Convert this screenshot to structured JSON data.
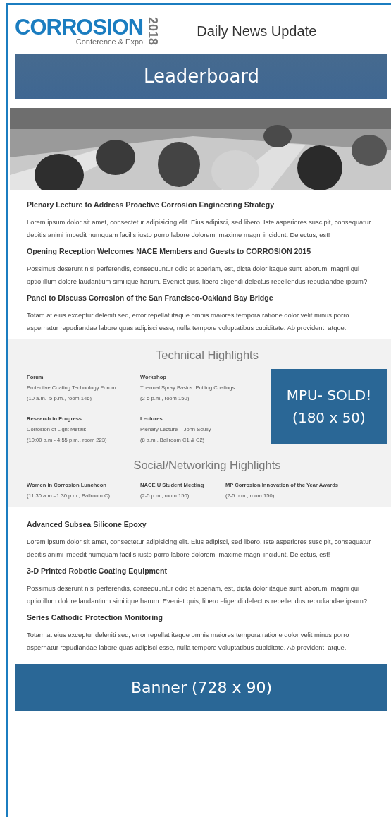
{
  "header": {
    "logo": {
      "name": "CORROSION",
      "tagline": "Conference & Expo",
      "year": "2018"
    },
    "title": "Daily News Update"
  },
  "leaderboard_ad": {
    "label": "Leaderboard"
  },
  "articles_top": [
    {
      "headline": "Plenary Lecture to Address Proactive Corrosion Engineering Strategy",
      "body": "Lorem ipsum dolor sit amet, consectetur adipisicing elit. Eius adipisci, sed libero. Iste asperiores suscipit, consequatur debitis animi impedit numquam facilis iusto porro labore dolorem, maxime magni incidunt. Delectus, est!"
    },
    {
      "headline": "Opening Reception Welcomes NACE Members and Guests to CORROSION 2015",
      "body": "Possimus deserunt nisi perferendis, consequuntur odio et aperiam, est, dicta dolor itaque sunt laborum, magni qui optio illum dolore laudantium similique harum. Eveniet quis, libero eligendi delectus repellendus repudiandae ipsum?"
    },
    {
      "headline": "Panel to Discuss Corrosion of the San Francisco-Oakland Bay Bridge",
      "body": "Totam at eius exceptur deleniti sed, error repellat itaque omnis maiores tempora ratione dolor velit minus porro aspernatur repudiandae labore quas adipisci esse, nulla tempore voluptatibus cupiditate. Ab provident, atque."
    }
  ],
  "technical_highlights": {
    "title": "Technical Highlights",
    "items": [
      {
        "category": "Forum",
        "event": "Protective Coating Technology Forum",
        "time": "(10 a.m.–5 p.m., room 146)"
      },
      {
        "category": "Workshop",
        "event": "Thermal Spray Basics: Putting Coatings",
        "time": "(2-5 p.m., room 150)"
      },
      {
        "category": "Research in Progress",
        "event": "Corrosion of Light Metals",
        "time": "(10:00 a.m - 4:55 p.m., room 223)"
      },
      {
        "category": "Lectures",
        "event": "Plenary Lecture – John Scully",
        "time": "(8 a.m., Ballroom C1 & C2)"
      }
    ]
  },
  "mpu_ad": {
    "label": "MPU- SOLD!",
    "size": "(180 x 50)"
  },
  "social_highlights": {
    "title": "Social/Networking Highlights",
    "items": [
      {
        "event": "Women in Corrosion Luncheon",
        "time": "(11:30 a.m.–1:30 p.m., Ballroom C)"
      },
      {
        "event": "NACE U Student Meeting",
        "time": "(2-5 p.m., room 150)"
      },
      {
        "event": "MP Corrosion Innovation of the Year Awards",
        "time": "(2-5 p.m., room 150)"
      }
    ]
  },
  "articles_bottom": [
    {
      "headline": "Advanced Subsea Silicone Epoxy",
      "body": "Lorem ipsum dolor sit amet, consectetur adipisicing elit. Eius adipisci, sed libero. Iste asperiores suscipit, consequatur debitis animi impedit numquam facilis iusto porro labore dolorem, maxime magni incidunt. Delectus, est!"
    },
    {
      "headline": "3-D Printed Robotic Coating Equipment",
      "body": "Possimus deserunt nisi perferendis, consequuntur odio et aperiam, est, dicta dolor itaque sunt laborum, magni qui optio illum dolore laudantium similique harum. Eveniet quis, libero eligendi delectus repellendus repudiandae ipsum?"
    },
    {
      "headline": "Series Cathodic Protection Monitoring",
      "body": "Totam at eius exceptur deleniti sed, error repellat itaque omnis maiores tempora ratione dolor velit minus porro aspernatur repudiandae labore quas adipisci esse, nulla tempore voluptatibus cupiditate. Ab provident, atque."
    }
  ],
  "banner_ad": {
    "label": "Banner (728 x 90)"
  }
}
